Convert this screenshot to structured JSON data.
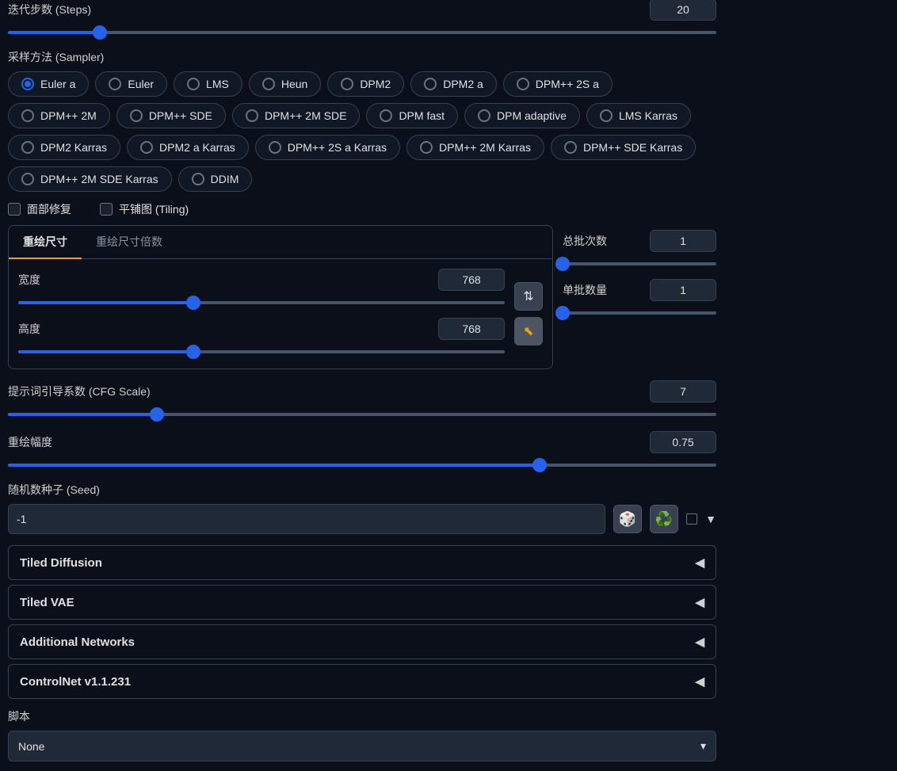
{
  "steps": {
    "label": "迭代步数 (Steps)",
    "value": "20",
    "percent": 13
  },
  "sampler": {
    "label": "采样方法 (Sampler)",
    "selected": 0,
    "options": [
      "Euler a",
      "Euler",
      "LMS",
      "Heun",
      "DPM2",
      "DPM2 a",
      "DPM++ 2S a",
      "DPM++ 2M",
      "DPM++ SDE",
      "DPM++ 2M SDE",
      "DPM fast",
      "DPM adaptive",
      "LMS Karras",
      "DPM2 Karras",
      "DPM2 a Karras",
      "DPM++ 2S a Karras",
      "DPM++ 2M Karras",
      "DPM++ SDE Karras",
      "DPM++ 2M SDE Karras",
      "DDIM"
    ]
  },
  "checks": {
    "face": {
      "label": "面部修复",
      "checked": false
    },
    "tiling": {
      "label": "平铺图 (Tiling)",
      "checked": false
    }
  },
  "resize": {
    "tab1": "重绘尺寸",
    "tab2": "重绘尺寸倍数",
    "width": {
      "label": "宽度",
      "value": "768",
      "percent": 36
    },
    "height": {
      "label": "高度",
      "value": "768",
      "percent": 36
    }
  },
  "batch": {
    "count": {
      "label": "总批次数",
      "value": "1",
      "percent": 0
    },
    "size": {
      "label": "单批数量",
      "value": "1",
      "percent": 0
    }
  },
  "cfg": {
    "label": "提示词引导系数 (CFG Scale)",
    "value": "7",
    "percent": 21
  },
  "denoise": {
    "label": "重绘幅度",
    "value": "0.75",
    "percent": 75
  },
  "seed": {
    "label": "随机数种子 (Seed)",
    "value": "-1"
  },
  "accordions": [
    "Tiled Diffusion",
    "Tiled VAE",
    "Additional Networks",
    "ControlNet v1.1.231"
  ],
  "script": {
    "label": "脚本",
    "value": "None"
  }
}
